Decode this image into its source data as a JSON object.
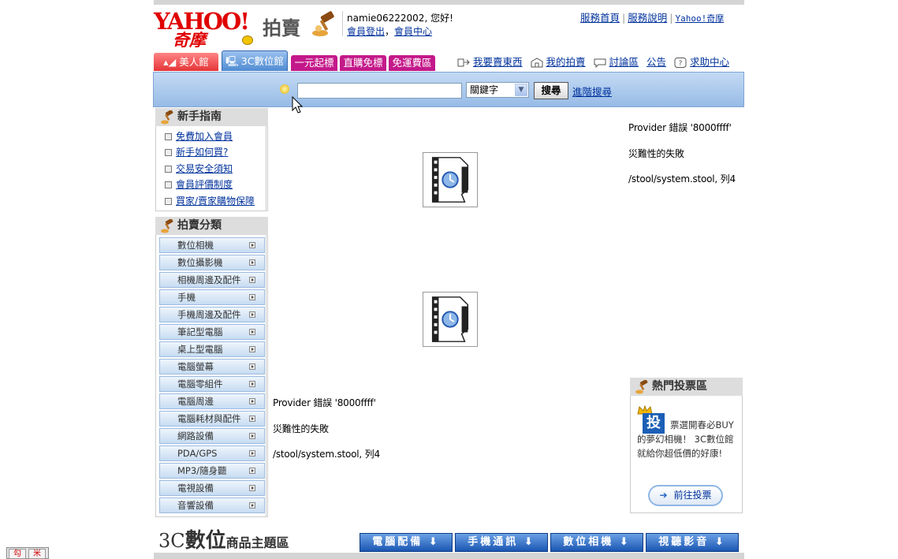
{
  "header": {
    "logo_text": "YAHOO!",
    "logo_sub": "奇摩",
    "brand": "拍賣",
    "greeting": "namie06222002, 您好!",
    "logout": "會員登出",
    "comma": "，",
    "member_center": "會員中心",
    "links": [
      "服務首頁",
      "服務說明",
      "Yahoo!奇摩"
    ]
  },
  "tabs": [
    "美人館",
    "3C數位館",
    "一元起標",
    "直購免標",
    "免運費區"
  ],
  "nav": [
    "我要賣東西",
    "我的拍賣",
    "討論區",
    "公告",
    "求助中心"
  ],
  "search": {
    "placeholder": "",
    "select_value": "關鍵字",
    "button": "搜尋",
    "advanced": "進階搜尋"
  },
  "guide": {
    "title": "新手指南",
    "items": [
      "免費加入會員",
      "新手如何買?",
      "交易安全須知",
      "會員評價制度",
      "買家/賣家購物保障"
    ]
  },
  "categories": {
    "title": "拍賣分類",
    "items": [
      "數位相機",
      "數位攝影機",
      "相機周邊及配件",
      "手機",
      "手機周邊及配件",
      "筆記型電腦",
      "桌上型電腦",
      "電腦螢幕",
      "電腦零組件",
      "電腦周邊",
      "電腦耗材與配件",
      "網路設備",
      "PDA/GPS",
      "MP3/隨身聽",
      "電視設備",
      "音響設備"
    ]
  },
  "error_top": [
    "Provider 錯誤 '8000ffff'",
    "災難性的失敗",
    "/stool/system.stool, 列4"
  ],
  "error_mid": [
    "Provider 錯誤 '8000ffff'",
    "災難性的失敗",
    "/stool/system.stool, 列4"
  ],
  "vote": {
    "title": "熱門投票區",
    "badge": "投",
    "text": "票選開春必BUY的夢幻相機！ 3C數位館就給你超低價的好康!",
    "button": "前往投票"
  },
  "theme": {
    "part1": "3C",
    "part2": "數位",
    "part3": "商品主題區",
    "buttons": [
      "電腦配備",
      "手機通訊",
      "數位相機",
      "視聽影音"
    ]
  },
  "ime": [
    "勾",
    "米"
  ],
  "colors": {
    "accent": "#00329c",
    "search_bg": "#c4daf4",
    "tab_pink": "#c4198a",
    "tab_red": "#e53538"
  }
}
